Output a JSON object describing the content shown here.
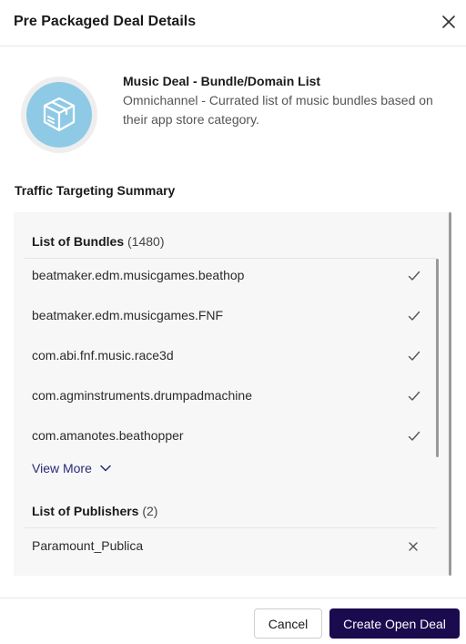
{
  "modal": {
    "title": "Pre Packaged Deal Details"
  },
  "deal": {
    "name": "Music Deal - Bundle/Domain List",
    "description": "Omnichannel - Currated list of music bundles based on their app store category.",
    "icon": "package-box-icon"
  },
  "targeting": {
    "title": "Traffic Targeting Summary",
    "bundles": {
      "label": "List of Bundles",
      "count": "(1480)",
      "items": [
        {
          "name": "beatmaker.edm.musicgames.beathop",
          "status_icon": "check-icon"
        },
        {
          "name": "beatmaker.edm.musicgames.FNF",
          "status_icon": "check-icon"
        },
        {
          "name": "com.abi.fnf.music.race3d",
          "status_icon": "check-icon"
        },
        {
          "name": "com.agminstruments.drumpadmachine",
          "status_icon": "check-icon"
        },
        {
          "name": "com.amanotes.beathopper",
          "status_icon": "check-icon"
        }
      ],
      "view_more": "View More"
    },
    "publishers": {
      "label": "List of Publishers",
      "count": "(2)",
      "items": [
        {
          "name": "Paramount_Publica",
          "status_icon": "x-icon"
        }
      ]
    }
  },
  "footer": {
    "cancel_label": "Cancel",
    "create_label": "Create Open Deal"
  },
  "colors": {
    "primary_button": "#1a0a4e",
    "link": "#2a2a7a",
    "icon_circle": "#8ecae6",
    "panel_background": "#f7f7f7"
  }
}
